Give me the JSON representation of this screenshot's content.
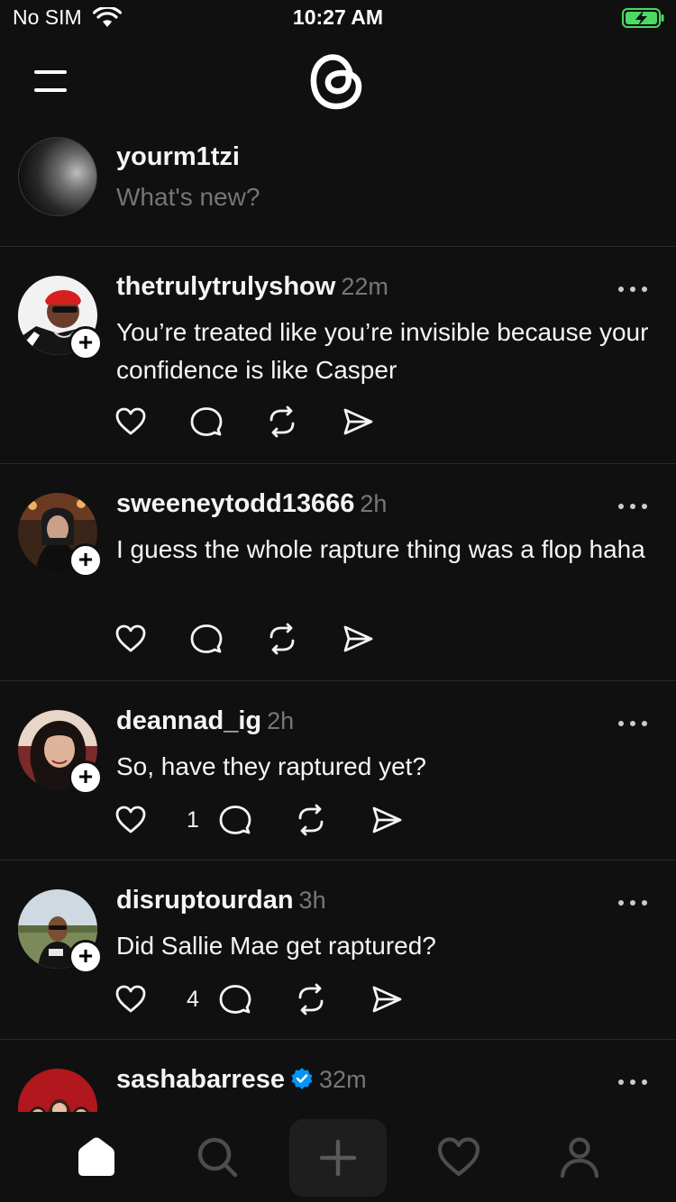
{
  "status_bar": {
    "carrier": "No SIM",
    "time": "10:27 AM",
    "battery_color": "#4cd964"
  },
  "compose": {
    "username": "yourm1tzi",
    "placeholder": "What's new?"
  },
  "posts": [
    {
      "username": "thetrulytrulyshow",
      "time": "22m",
      "text": "You’re treated like you’re invisible because your confidence is like Casper",
      "likes": "",
      "verified": false
    },
    {
      "username": "sweeneytodd13666",
      "time": "2h",
      "text": "I guess the whole rapture thing was a flop haha",
      "likes": "",
      "verified": false
    },
    {
      "username": "deannad_ig",
      "time": "2h",
      "text": "So, have they raptured yet?",
      "likes": "1",
      "verified": false
    },
    {
      "username": "disruptourdan",
      "time": "3h",
      "text": "Did Sallie Mae get raptured?",
      "likes": "4",
      "verified": false
    },
    {
      "username": "sashabarrese",
      "time": "32m",
      "text": "",
      "likes": "",
      "verified": true
    }
  ],
  "colors": {
    "background": "#101010",
    "text": "#f3f5f7",
    "muted": "#777777",
    "divider": "#2a2a2a",
    "verified": "#0095f6"
  },
  "icons": {
    "menu": "menu-icon",
    "logo": "threads-logo",
    "home": "home-icon",
    "search": "search-icon",
    "create": "plus-icon",
    "activity": "heart-icon",
    "profile": "person-icon"
  }
}
